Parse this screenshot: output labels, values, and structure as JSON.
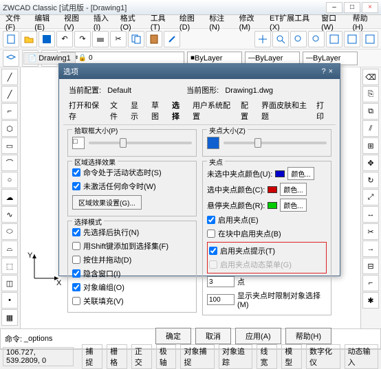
{
  "app": {
    "title": "ZWCAD Classic [试用版 - [Drawing1]"
  },
  "menu": [
    "文件(F)",
    "编辑(E)",
    "视图(V)",
    "插入(I)",
    "格式(O)",
    "工具(T)",
    "绘图(D)",
    "标注(N)",
    "修改(M)",
    "ET扩展工具(X)",
    "窗口(W)",
    "帮助(H)"
  ],
  "layer": {
    "bylayer": "ByLayer"
  },
  "doctab": "Drawing1",
  "dialog": {
    "title": "选项",
    "cur_profile_label": "当前配置:",
    "cur_profile": "Default",
    "cur_dwg_label": "当前图形:",
    "cur_dwg": "Drawing1.dwg",
    "tabs": [
      "打开和保存",
      "文件",
      "显示",
      "草图",
      "选择",
      "用户系统配置",
      "配置",
      "界面皮肤和主题",
      "打印"
    ],
    "pickbox_label": "拾取框大小(P)",
    "gripsize_label": "夹点大小(Z)",
    "selmode_title": "区域选择效果",
    "chk_cmd_active": "命令处于活动状态时(S)",
    "chk_not_cmd": "未激活任何命令时(W)",
    "btn_visual": "区域效果设置(G)...",
    "pickmode_title": "选择模式",
    "chk_pre_post": "先选择后执行(N)",
    "chk_shift": "用Shift键添加到选择集(F)",
    "chk_press_drag": "按住并拖动(D)",
    "chk_implied": "隐含窗口(I)",
    "chk_group": "对象编组(O)",
    "chk_hatch": "关联填充(V)",
    "grip_title": "夹点",
    "unsel_color": "未选中夹点颜色(U):",
    "sel_color": "选中夹点颜色(C):",
    "hover_color": "悬停夹点颜色(R):",
    "color_opt": "颜色...",
    "chk_enable_grip": "启用夹点(E)",
    "chk_block_grip": "在块中启用夹点(B)",
    "chk_grip_tip": "启用夹点提示(T)",
    "chk_grip_dyn": "启用夹点动态菜单(G)",
    "grip_limit_label": "显示夹点时限制对象选择(M)",
    "grip_limit": "100",
    "pts_label": "点",
    "pts_val": "3",
    "btn_ok": "确定",
    "btn_cancel": "取消",
    "btn_apply": "应用(A)",
    "btn_help": "帮助(H)"
  },
  "cmd": {
    "prompt": "命令:",
    "text": "_options"
  },
  "status": {
    "coords": "106.727, 539.2809, 0",
    "btns": [
      "捕捉",
      "栅格",
      "正交",
      "极轴",
      "对象捕捉",
      "对象追踪",
      "线宽",
      "模型",
      "数字化仪",
      "动态输入"
    ]
  }
}
